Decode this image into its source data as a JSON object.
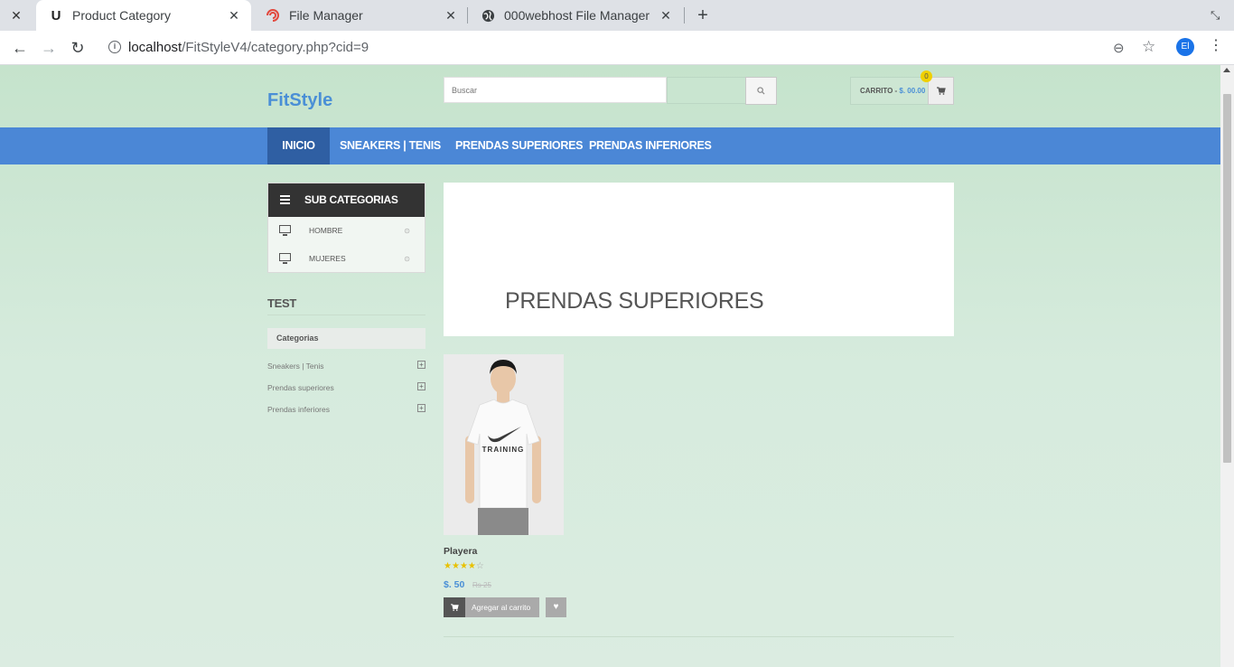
{
  "browser": {
    "tabs": [
      {
        "title": "Product Category",
        "favicon": "U"
      },
      {
        "title": "File Manager",
        "favicon": "swirl"
      },
      {
        "title": "000webhost File Manager",
        "favicon": "globe"
      }
    ],
    "url_host": "localhost",
    "url_path": "/FitStyleV4/category.php?cid=9",
    "profile_initials": "El"
  },
  "site": {
    "logo": "FitStyle",
    "search_placeholder": "Buscar",
    "cart_label": "CARRITO - ",
    "cart_amount": "$. 00.00",
    "cart_count": "0"
  },
  "nav": [
    {
      "label": "INICIO",
      "active": true
    },
    {
      "label": "SNEAKERS | TENIS"
    },
    {
      "label": "PRENDAS SUPERIORES"
    },
    {
      "label": "PRENDAS INFERIORES"
    }
  ],
  "sidebar": {
    "subcategories_title": "SUB CATEGORIAS",
    "subcategories": [
      {
        "label": "HOMBRE",
        "icon": "monitor-icon"
      },
      {
        "label": "MUJERES",
        "icon": "monitor-icon"
      }
    ],
    "test_title": "TEST",
    "categories_title": "Categorias",
    "categories": [
      {
        "label": "Sneakers | Tenis"
      },
      {
        "label": "Prendas superiores"
      },
      {
        "label": "Prendas inferiores"
      }
    ]
  },
  "main": {
    "banner_title": "PRENDAS SUPERIORES",
    "product": {
      "name": "Playera",
      "rating": 4,
      "rating_max": 5,
      "price": "$. 50",
      "old_price": "Rs 25",
      "add_to_cart": "Agregar al carrito",
      "shirt_text": "TRAINING"
    }
  },
  "colors": {
    "brand_blue": "#4b87d6",
    "nav_active": "#2f5fa3",
    "page_bg": "#c5e3cc",
    "star": "#e8c100"
  }
}
